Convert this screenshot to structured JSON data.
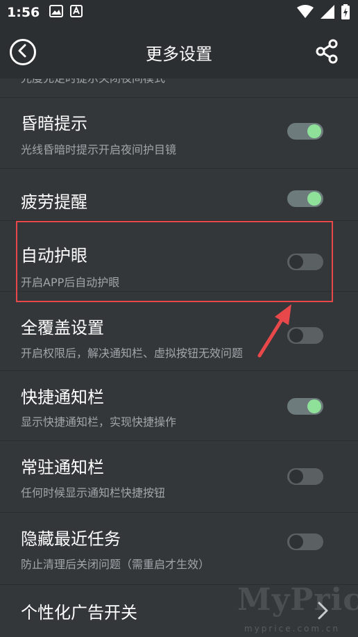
{
  "status_bar": {
    "time": "1:56"
  },
  "app_bar": {
    "title": "更多设置"
  },
  "partial_row": {
    "subtitle": "光度充足时提示关闭夜间模式"
  },
  "settings": [
    {
      "title": "昏暗提示",
      "subtitle": "光线昏暗时提示开启夜间护目镜",
      "enabled": true
    },
    {
      "title": "疲劳提醒",
      "subtitle": "",
      "enabled": true
    },
    {
      "title": "自动护眼",
      "subtitle": "开启APP后自动护眼",
      "enabled": false
    },
    {
      "title": "全覆盖设置",
      "subtitle": "开启权限后，解决通知栏、虚拟按钮无效问题",
      "enabled": false
    },
    {
      "title": "快捷通知栏",
      "subtitle": "显示快捷通知栏，实现快捷操作",
      "enabled": true
    },
    {
      "title": "常驻通知栏",
      "subtitle": "任何时候显示通知栏快捷按钮",
      "enabled": false
    },
    {
      "title": "隐藏最近任务",
      "subtitle": "防止清理后关闭问题（需重启才生效）",
      "enabled": false
    }
  ],
  "last_row": {
    "title": "个性化广告开关"
  },
  "watermark": {
    "brand": "MyPrice",
    "site": "myprice.com.cn"
  },
  "colors": {
    "toggle_on_knob": "#8fe19a",
    "highlight": "#e9484a",
    "background": "#33373a"
  }
}
